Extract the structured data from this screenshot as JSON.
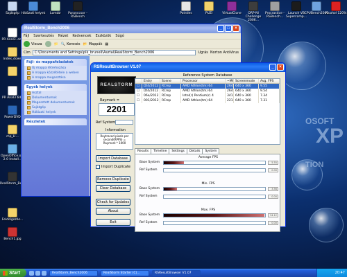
{
  "desktop": {
    "top_icons": [
      "Sajátgép",
      "Hálózati helyek",
      "Lomtár",
      "Paranccsor - RSBench",
      "",
      "",
      "",
      "",
      "",
      "",
      "Pointles",
      "PUZI",
      "VirtualClone",
      "ORP-NI Challenge 2006...",
      "Procrastice - RSBench...",
      "Launch VB Supercomp...",
      "CPUBench2003",
      "Alcohol 120%"
    ],
    "left_icons": [
      "PR Anal3..doc",
      "Index_down",
      "",
      "",
      "PR Anal3 6dd",
      "PowerDVD",
      "mp_LI...",
      "OpenOffice.org 2.0 Install...",
      "RealStorm_Bench",
      "Feldolgozás...",
      "Bench1.jpg"
    ],
    "logo_text": "XP",
    "logo_sub": "OSOFT",
    "logo_edition": "TION"
  },
  "explorer": {
    "title": "RealStorm_Bench2006",
    "menu": [
      "Fájl",
      "Szerkesztés",
      "Nézet",
      "Kedvencek",
      "Eszközök",
      "Súgó"
    ],
    "toolbar": {
      "back": "Vissza",
      "search": "Keresés",
      "folders": "Mappák"
    },
    "address_label": "Cím",
    "address": "C:\\Documents and Settings\\plk_brunell\\Asztal\\RealStorm_Bench2006",
    "go_label": "Ugrás",
    "norton": "Norton AntiVirus",
    "task_sections": [
      {
        "title": "Fájl- és mappafeladatok",
        "items": [
          "Új mappa létrehozása",
          "A mappa közzététele a weben",
          "A mappa megosztása"
        ]
      },
      {
        "title": "Egyéb helyek",
        "items": [
          "Asztal",
          "Dokumentumok",
          "Megosztott dokumentumok",
          "Sajátgép",
          "Hálózati helyek"
        ]
      },
      {
        "title": "Részletek",
        "items": []
      }
    ]
  },
  "rs": {
    "title": "RSResultBrowser V1.07",
    "logo": "REALSTORM",
    "raymark_label": "Raymark =",
    "raymark_value": "2201",
    "ref_system_label": "Ref System",
    "info_label": "Information",
    "info_text": "Raytraced pixels per second(RPPS) = Raymark * 1000",
    "db_title": "Reference System Database",
    "columns": [
      "",
      "Entry",
      "Scene",
      "Processor",
      "~MHz",
      "Screenmode",
      "Avg. FPS"
    ],
    "rows": [
      {
        "entry": "Dt4/2012",
        "scene": "RCmp",
        "proc": "AMD Athlon(tm) 64",
        "mhz": "2648",
        "mode": "640 x 360",
        "fps": "9.55",
        "sel": true
      },
      {
        "entry": "Dt4/2012",
        "scene": "RCmp",
        "proc": "AMD Athlon(tm) 64",
        "mhz": "2648",
        "mode": "640 x 360",
        "fps": "9.54",
        "sel": false
      },
      {
        "entry": "06e/2012",
        "scene": "RCmp",
        "proc": "Intel(r) Pentium(r) 4",
        "mhz": "3410",
        "mode": "640 x 360",
        "fps": "7.34",
        "sel": false
      },
      {
        "entry": "001/2012",
        "scene": "RCmp",
        "proc": "AMD Athlon(tm) 64",
        "mhz": "2210",
        "mode": "640 x 360",
        "fps": "7.31",
        "sel": false
      }
    ],
    "buttons": {
      "import_db": "Import Database",
      "import_dup": "Import Duplicate",
      "remove_dup": "Remove Duplicate",
      "clear_db": "Clear Database",
      "check_updates": "Check for Updates",
      "about": "About",
      "exit": "Exit"
    },
    "tabs": [
      "Results",
      "Timeline",
      "Settings",
      "Details",
      "System"
    ],
    "fps_sections": [
      {
        "title": "Average FPS",
        "base_label": "Base System",
        "ref_label": "Ref System",
        "base_fraction": 0.2,
        "base_value": "5.55",
        "ref_value": "0.00"
      },
      {
        "title": "Min. FPS",
        "base_label": "Base System",
        "ref_label": "Ref System",
        "base_fraction": 0.13,
        "base_value": "3.56",
        "ref_value": "0.00"
      },
      {
        "title": "Max. FPS",
        "base_label": "Base System",
        "ref_label": "Ref System",
        "base_fraction": 0.99,
        "base_value": "34.12",
        "ref_value": "0.00"
      }
    ]
  },
  "taskbar": {
    "start": "Start",
    "tasks": [
      "RealStorm_Bench2006",
      "RealStorm Starter (C)...",
      "RSResultBrowser V1.07"
    ],
    "clock": "20:47"
  }
}
